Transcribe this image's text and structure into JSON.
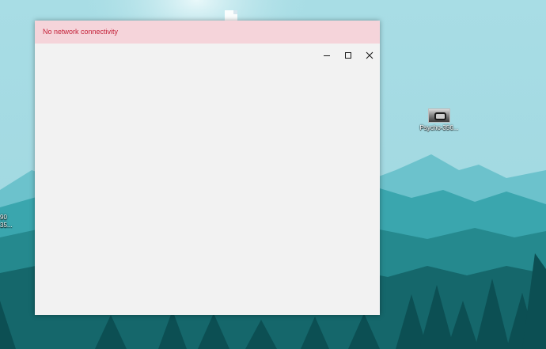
{
  "notification": {
    "message": "No network connectivity",
    "text_color": "#c4223a",
    "background_color": "#f5d4da"
  },
  "window": {
    "background_color": "#f2f2f2",
    "controls": {
      "minimize_icon": "minimize-icon",
      "maximize_icon": "maximize-icon",
      "close_icon": "close-icon"
    }
  },
  "desktop": {
    "icons": [
      {
        "label": "Psycho-356...",
        "icon": "image-file-icon"
      }
    ],
    "partial_labels": {
      "left_line1": "90",
      "left_line2": "35..."
    },
    "background_palette": {
      "sky": "#9fd8e1",
      "far_mountains": "#5cb8c4",
      "mid_mountains": "#2f9ba3",
      "near_hills": "#1f7f84",
      "forest": "#0f5a5e"
    }
  }
}
